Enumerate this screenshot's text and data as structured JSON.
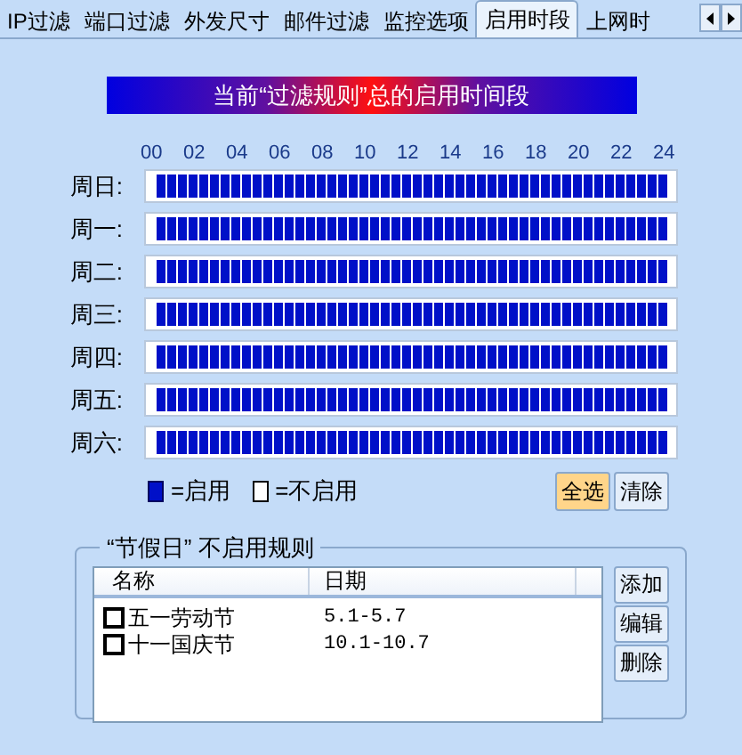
{
  "tabs": [
    {
      "label": "IP过滤",
      "selected": false
    },
    {
      "label": "端口过滤",
      "selected": false
    },
    {
      "label": "外发尺寸",
      "selected": false
    },
    {
      "label": "邮件过滤",
      "selected": false
    },
    {
      "label": "监控选项",
      "selected": false
    },
    {
      "label": "启用时段",
      "selected": true
    },
    {
      "label": "上网时",
      "selected": false
    }
  ],
  "banner": "当前“过滤规则”总的启用时间段",
  "hours": [
    "00",
    "02",
    "04",
    "06",
    "08",
    "10",
    "12",
    "14",
    "16",
    "18",
    "20",
    "22",
    "24"
  ],
  "days": [
    {
      "label": "周日:",
      "slots": [
        true,
        true,
        true,
        true,
        true,
        true,
        true,
        true,
        true,
        true,
        true,
        true,
        true,
        true,
        true,
        true,
        true,
        true,
        true,
        true,
        true,
        true,
        true,
        true,
        true,
        true,
        true,
        true,
        true,
        true,
        true,
        true,
        true,
        true,
        true,
        true,
        true,
        true,
        true,
        true,
        true,
        true,
        true,
        true,
        true,
        true,
        true,
        true
      ]
    },
    {
      "label": "周一:",
      "slots": [
        true,
        true,
        true,
        true,
        true,
        true,
        true,
        true,
        true,
        true,
        true,
        true,
        true,
        true,
        true,
        true,
        true,
        true,
        true,
        true,
        true,
        true,
        true,
        true,
        true,
        true,
        true,
        true,
        true,
        true,
        true,
        true,
        true,
        true,
        true,
        true,
        true,
        true,
        true,
        true,
        true,
        true,
        true,
        true,
        true,
        true,
        true,
        true
      ]
    },
    {
      "label": "周二:",
      "slots": [
        true,
        true,
        true,
        true,
        true,
        true,
        true,
        true,
        true,
        true,
        true,
        true,
        true,
        true,
        true,
        true,
        true,
        true,
        true,
        true,
        true,
        true,
        true,
        true,
        true,
        true,
        true,
        true,
        true,
        true,
        true,
        true,
        true,
        true,
        true,
        true,
        true,
        true,
        true,
        true,
        true,
        true,
        true,
        true,
        true,
        true,
        true,
        true
      ]
    },
    {
      "label": "周三:",
      "slots": [
        true,
        true,
        true,
        true,
        true,
        true,
        true,
        true,
        true,
        true,
        true,
        true,
        true,
        true,
        true,
        true,
        true,
        true,
        true,
        true,
        true,
        true,
        true,
        true,
        true,
        true,
        true,
        true,
        true,
        true,
        true,
        true,
        true,
        true,
        true,
        true,
        true,
        true,
        true,
        true,
        true,
        true,
        true,
        true,
        true,
        true,
        true,
        true
      ]
    },
    {
      "label": "周四:",
      "slots": [
        true,
        true,
        true,
        true,
        true,
        true,
        true,
        true,
        true,
        true,
        true,
        true,
        true,
        true,
        true,
        true,
        true,
        true,
        true,
        true,
        true,
        true,
        true,
        true,
        true,
        true,
        true,
        true,
        true,
        true,
        true,
        true,
        true,
        true,
        true,
        true,
        true,
        true,
        true,
        true,
        true,
        true,
        true,
        true,
        true,
        true,
        true,
        true
      ]
    },
    {
      "label": "周五:",
      "slots": [
        true,
        true,
        true,
        true,
        true,
        true,
        true,
        true,
        true,
        true,
        true,
        true,
        true,
        true,
        true,
        true,
        true,
        true,
        true,
        true,
        true,
        true,
        true,
        true,
        true,
        true,
        true,
        true,
        true,
        true,
        true,
        true,
        true,
        true,
        true,
        true,
        true,
        true,
        true,
        true,
        true,
        true,
        true,
        true,
        true,
        true,
        true,
        true
      ]
    },
    {
      "label": "周六:",
      "slots": [
        true,
        true,
        true,
        true,
        true,
        true,
        true,
        true,
        true,
        true,
        true,
        true,
        true,
        true,
        true,
        true,
        true,
        true,
        true,
        true,
        true,
        true,
        true,
        true,
        true,
        true,
        true,
        true,
        true,
        true,
        true,
        true,
        true,
        true,
        true,
        true,
        true,
        true,
        true,
        true,
        true,
        true,
        true,
        true,
        true,
        true,
        true,
        true
      ]
    }
  ],
  "legend": [
    {
      "label": "=启用",
      "enabled": true
    },
    {
      "label": "=不启用",
      "enabled": false
    }
  ],
  "grid_buttons": [
    {
      "label": "全选",
      "highlighted": true
    },
    {
      "label": "清除",
      "highlighted": false
    }
  ],
  "holidays": {
    "title": "“节假日” 不启用规则",
    "columns": [
      "名称",
      "日期"
    ],
    "rows": [
      {
        "name": "五一劳动节",
        "date": "5.1-5.7",
        "checked": false
      },
      {
        "name": "十一国庆节",
        "date": "10.1-10.7",
        "checked": false
      }
    ],
    "buttons": [
      "添加",
      "编辑",
      "删除"
    ]
  }
}
